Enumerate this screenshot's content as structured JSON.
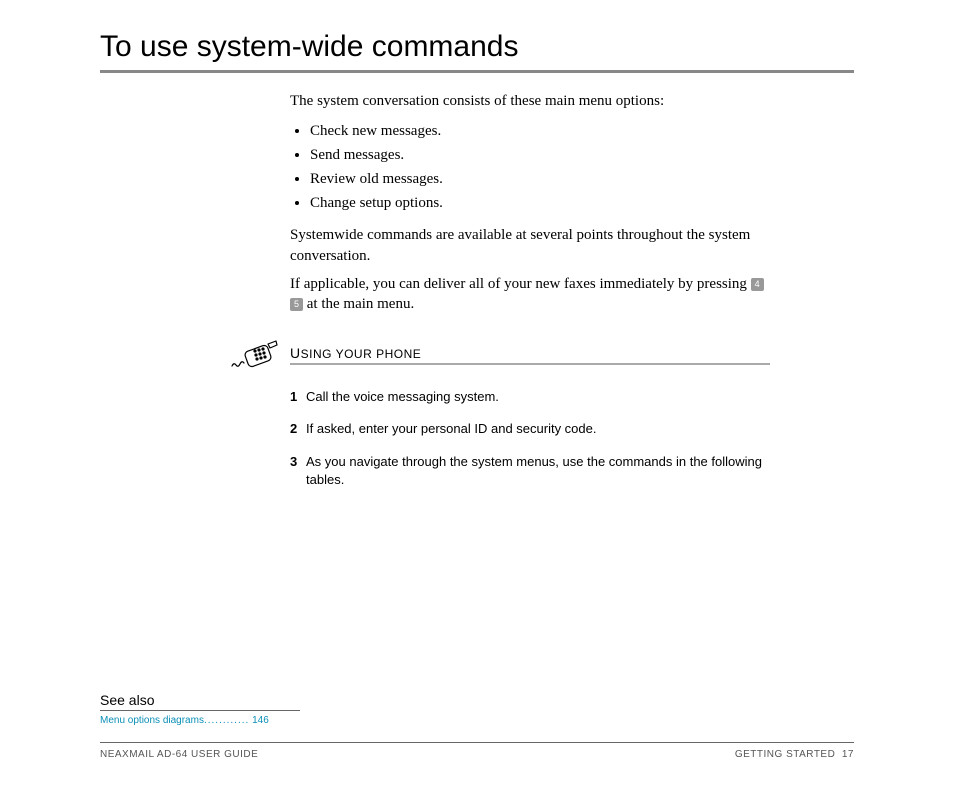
{
  "title": "To use system-wide commands",
  "intro": "The system conversation consists of these main menu options:",
  "bullets": [
    "Check new messages.",
    "Send messages.",
    "Review old messages.",
    "Change setup options."
  ],
  "para2": "Systemwide commands are available at several points throughout the system conversation.",
  "para3a": "If applicable, you can deliver all of your new faxes immediately by pressing ",
  "key1": "4",
  "key2": "5",
  "para3b": " at the main menu.",
  "section_label_first": "U",
  "section_label_rest": "SING YOUR PHONE",
  "steps": [
    "Call the voice messaging system.",
    "If asked, enter your personal ID and security code.",
    "As you navigate through the system menus, use the commands in the following tables."
  ],
  "see_also_title": "See also",
  "see_also_link_text": "Menu options diagrams",
  "see_also_link_dots": "............",
  "see_also_link_page": "146",
  "footer_left": "NEAXMAIL AD-64 USER GUIDE",
  "footer_right_label": "GETTING STARTED",
  "footer_page": "17"
}
